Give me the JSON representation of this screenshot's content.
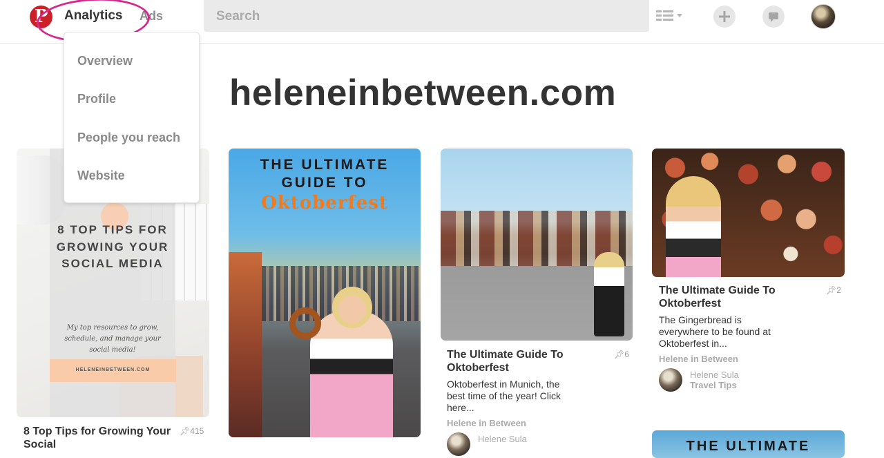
{
  "header": {
    "logo": "P",
    "nav_analytics": "Analytics",
    "nav_ads": "Ads",
    "search_placeholder": "Search"
  },
  "dropdown": {
    "items": [
      {
        "label": "Overview"
      },
      {
        "label": "Profile"
      },
      {
        "label": "People you reach"
      },
      {
        "label": "Website"
      }
    ]
  },
  "page_title": "heleneinbetween.com",
  "pins": [
    {
      "art_heading": "8 TOP TIPS FOR GROWING YOUR SOCIAL MEDIA",
      "art_sub": "My top resources to grow, schedule, and manage your social media!",
      "art_band": "HELENEINBETWEEN.COM",
      "title": "8 Top Tips for Growing Your Social",
      "count": "415"
    },
    {
      "art_line1": "THE ULTIMATE",
      "art_line2": "GUIDE TO",
      "art_line3": "Oktoberfest"
    },
    {
      "title": "The Ultimate Guide To Oktoberfest",
      "count": "6",
      "description": "Oktoberfest in Munich, the best time of the year! Click here...",
      "source": "Helene in Between",
      "user_name": "Helene Sula"
    },
    {
      "title": "The Ultimate Guide To Oktoberfest",
      "count": "2",
      "description": "The Gingerbread is everywhere to be found at Oktoberfest in...",
      "source": "Helene in Between",
      "user_name": "Helene Sula",
      "user_board": "Travel Tips"
    },
    {
      "art_partial": "THE ULTIMATE"
    }
  ],
  "colors": {
    "brand_red": "#cb2027",
    "highlight_ring": "#d6278f"
  },
  "icons": [
    "pinterest-logo-icon",
    "list-view-icon",
    "plus-icon",
    "message-icon",
    "pin-icon"
  ]
}
